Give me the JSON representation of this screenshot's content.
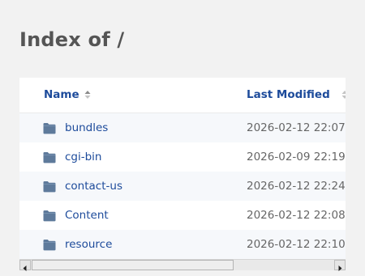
{
  "page": {
    "title": "Index of /"
  },
  "table": {
    "columns": {
      "name": "Name",
      "last_modified": "Last Modified"
    },
    "sort": {
      "column": "name",
      "icon": "sort-arrows-icon"
    },
    "rows": [
      {
        "icon": "folder-icon",
        "name": "bundles",
        "last_modified": "2026-02-12 22:07"
      },
      {
        "icon": "folder-icon",
        "name": "cgi-bin",
        "last_modified": "2026-02-09 22:19"
      },
      {
        "icon": "folder-icon",
        "name": "contact-us",
        "last_modified": "2026-02-12 22:24"
      },
      {
        "icon": "folder-icon",
        "name": "Content",
        "last_modified": "2026-02-12 22:08"
      },
      {
        "icon": "folder-icon",
        "name": "resource",
        "last_modified": "2026-02-12 22:10"
      }
    ]
  },
  "colors": {
    "link": "#1d4b9b",
    "folder": "#5e7a9b",
    "title": "#555555",
    "date": "#666666",
    "row_alt": "#f6f8fb",
    "background": "#f2f2f2"
  }
}
